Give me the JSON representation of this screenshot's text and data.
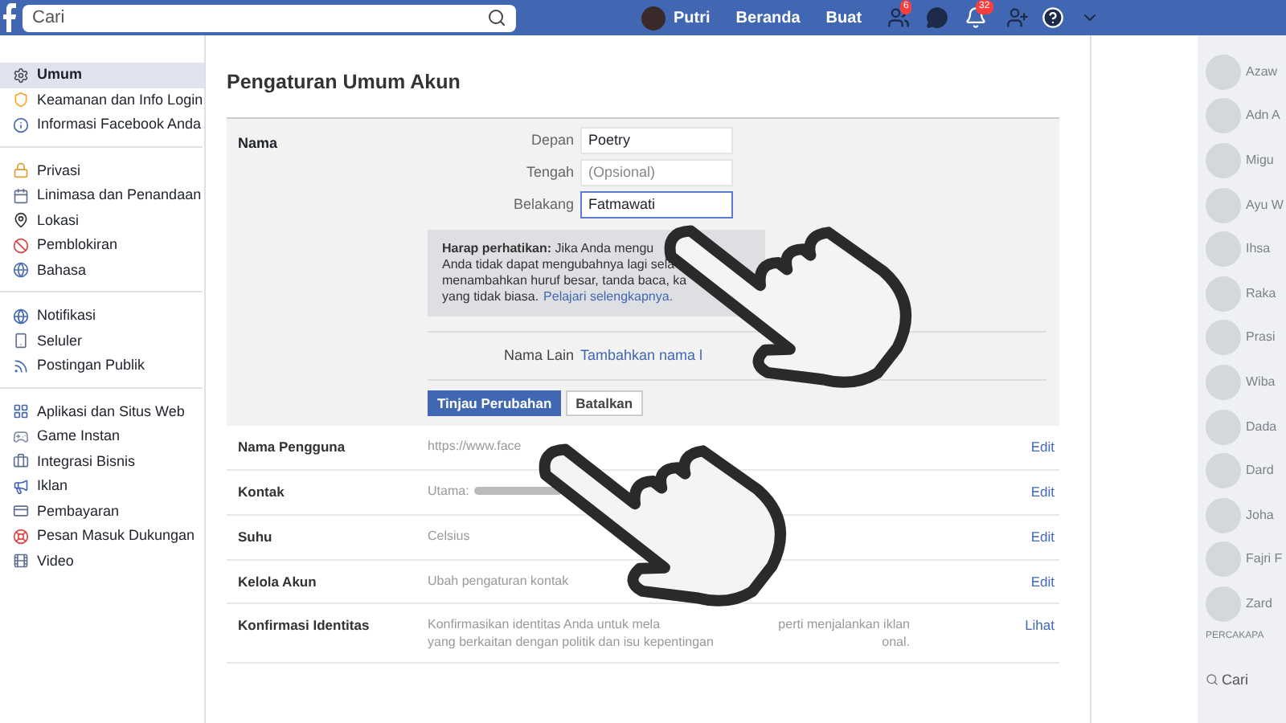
{
  "topbar": {
    "search": {
      "placeholder": "Cari"
    },
    "profile_name": "Putri",
    "nav": [
      "Beranda",
      "Buat"
    ],
    "friend_badge": "6",
    "notification_badge": "32"
  },
  "sidebar": {
    "groups": [
      [
        {
          "label": "Umum",
          "selected": true
        },
        {
          "label": "Keamanan dan Info Login",
          "selected": false
        },
        {
          "label": "Informasi Facebook Anda",
          "selected": false
        }
      ],
      [
        {
          "label": "Privasi",
          "selected": false
        },
        {
          "label": "Linimasa dan Penandaan",
          "selected": false
        },
        {
          "label": "Lokasi",
          "selected": false
        },
        {
          "label": "Pemblokiran",
          "selected": false
        },
        {
          "label": "Bahasa",
          "selected": false
        }
      ],
      [
        {
          "label": "Notifikasi",
          "selected": false
        },
        {
          "label": "Seluler",
          "selected": false
        },
        {
          "label": "Postingan Publik",
          "selected": false
        }
      ],
      [
        {
          "label": "Aplikasi dan Situs Web",
          "selected": false
        },
        {
          "label": "Game Instan",
          "selected": false
        },
        {
          "label": "Integrasi Bisnis",
          "selected": false
        },
        {
          "label": "Iklan",
          "selected": false
        },
        {
          "label": "Pembayaran",
          "selected": false
        },
        {
          "label": "Pesan Masuk Dukungan",
          "selected": false
        },
        {
          "label": "Video",
          "selected": false
        }
      ]
    ]
  },
  "content": {
    "title": "Pengaturan Umum Akun",
    "name_section": {
      "label": "Nama",
      "fields": [
        {
          "label": "Depan",
          "value": "Poetry",
          "focused": false
        },
        {
          "label": "Tengah",
          "placeholder": "(Opsional)",
          "focused": false
        },
        {
          "label": "Belakang",
          "value": "Fatmawati",
          "focused": true
        }
      ],
      "notice": {
        "lines": [
          "**Harap perhatikan:** Jika Anda mengu",
          "Anda tidak dapat mengubahnya lagi sela",
          "menambahkan huruf besar, tanda baca, ka"
        ],
        "last_line": "yang tidak biasa.",
        "link": "Pelajari selengkapnya."
      },
      "other_name": {
        "label": "Nama Lain",
        "link": "Tambahkan nama l"
      },
      "buttons": [
        {
          "label": "Tinjau Perubahan",
          "kind": "primary"
        },
        {
          "label": "Batalkan",
          "kind": "secondary"
        }
      ]
    },
    "rows": [
      {
        "label": "Nama Pengguna",
        "lines": [
          [
            "https://www.face"
          ]
        ],
        "redacted": false,
        "action": "Edit"
      },
      {
        "label": "Kontak",
        "lines": [
          [
            "Utama:"
          ]
        ],
        "redacted": true,
        "action": "Edit"
      },
      {
        "label": "Suhu",
        "lines": [
          [
            "Celsius"
          ]
        ],
        "redacted": false,
        "action": "Edit"
      },
      {
        "label": "Kelola Akun",
        "lines": [
          [
            "Ubah pengaturan kontak"
          ]
        ],
        "redacted": false,
        "action": "Edit"
      },
      {
        "label": "Konfirmasi Identitas",
        "lines": [
          [
            "Konfirmasikan identitas Anda untuk mela",
            "perti menjalankan iklan"
          ],
          [
            "yang berkaitan dengan politik dan isu kepentingan",
            "onal."
          ]
        ],
        "redacted": false,
        "action": "Lihat"
      }
    ]
  },
  "chat": {
    "contacts": [
      "Azaw",
      "Adn A",
      "Migu",
      "Ayu W",
      "Ihsa",
      "Raka",
      "Prasi",
      "Wiba",
      "Dada",
      "Dard",
      "Joha",
      "Fajri F",
      "Zard"
    ],
    "heading": "PERCAKAPA",
    "search": {
      "placeholder": "Cari"
    }
  }
}
